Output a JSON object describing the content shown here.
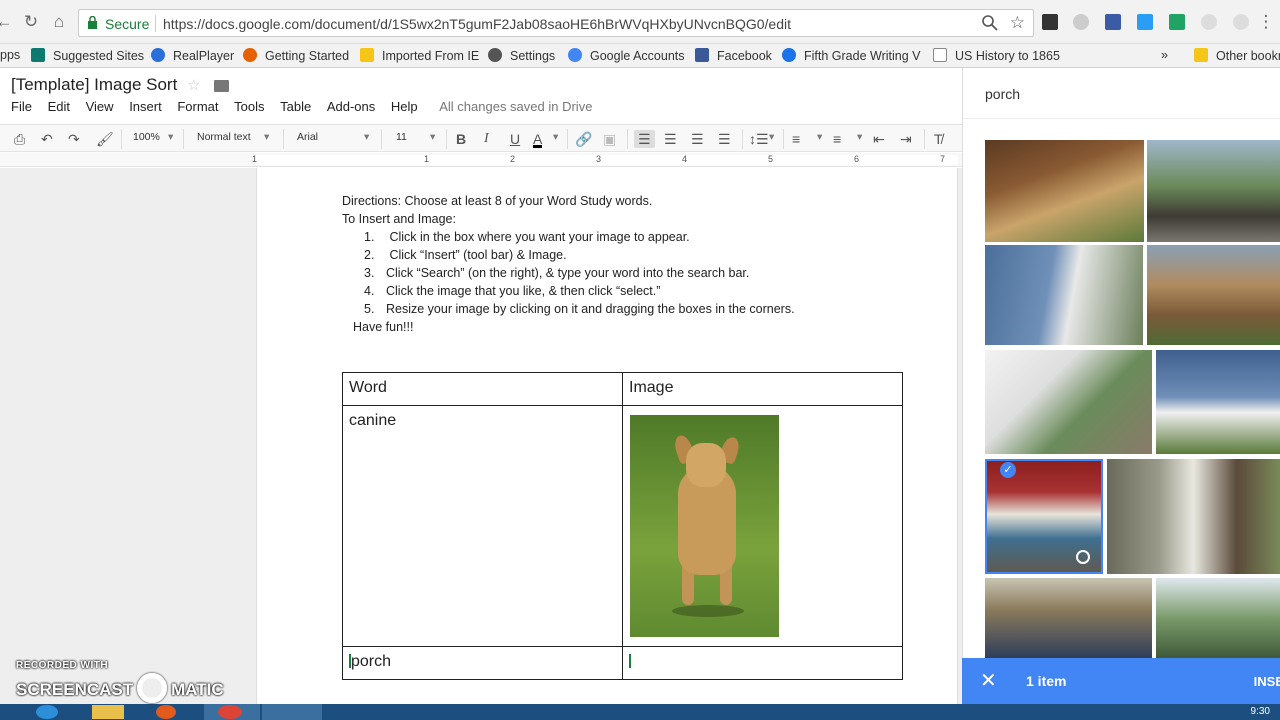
{
  "browser": {
    "secure_label": "Secure",
    "url": "https://docs.google.com/document/d/1S5wx2nT5gumF2Jab08saoHE6hBrWVqHXbyUNvcnBQG0/edit"
  },
  "bookmarks": [
    {
      "label": "pps",
      "icon": "apps-icon",
      "color": "#4285f4"
    },
    {
      "label": "Suggested Sites",
      "icon": "bing-icon",
      "color": "#0e7a6f"
    },
    {
      "label": "RealPlayer",
      "icon": "realplayer-icon",
      "color": "#2a6fdb"
    },
    {
      "label": "Getting Started",
      "icon": "firefox-icon",
      "color": "#e66000"
    },
    {
      "label": "Imported From IE",
      "icon": "folder-icon",
      "color": "#f5c518"
    },
    {
      "label": "Settings",
      "icon": "gear-icon",
      "color": "#555555"
    },
    {
      "label": "Google Accounts",
      "icon": "google-icon",
      "color": "#4285f4"
    },
    {
      "label": "Facebook",
      "icon": "facebook-icon",
      "color": "#3b5998"
    },
    {
      "label": "Fifth Grade Writing V",
      "icon": "site-icon",
      "color": "#1a73e8"
    },
    {
      "label": "US History to 1865",
      "icon": "page-icon",
      "color": "#888888"
    },
    {
      "label": "»",
      "icon": "more-icon",
      "color": "#555555"
    },
    {
      "label": "Other bookr",
      "icon": "folder-icon",
      "color": "#f5c518"
    }
  ],
  "doc": {
    "title": "[Template] Image Sort",
    "menus": [
      "File",
      "Edit",
      "View",
      "Insert",
      "Format",
      "Tools",
      "Table",
      "Add-ons",
      "Help"
    ],
    "save_status": "All changes saved in Drive"
  },
  "toolbar": {
    "zoom": "100%",
    "style": "Normal text",
    "font": "Arial",
    "size": "11"
  },
  "ruler": [
    "1",
    "1",
    "2",
    "3",
    "4",
    "5",
    "6",
    "7"
  ],
  "directions": {
    "line1": "Directions:  Choose at least 8 of your Word Study words.",
    "line2": "To Insert and Image:",
    "steps": [
      {
        "num": "1.",
        "text": " Click in the box where you want your image to appear."
      },
      {
        "num": "2.",
        "text": " Click “Insert” (tool bar) & Image."
      },
      {
        "num": "3.",
        "text": "Click “Search” (on the right), & type your word into the search bar."
      },
      {
        "num": "4.",
        "text": "Click the image that you like, & then click “select.”"
      },
      {
        "num": "5.",
        "text": "Resize your image by clicking on it and dragging the boxes in the corners."
      }
    ],
    "closing": "Have fun!!!"
  },
  "table": {
    "headers": [
      "Word",
      "Image"
    ],
    "rows": [
      "canine",
      "porch"
    ]
  },
  "panel": {
    "search_query": "porch",
    "selected_count": "1 item",
    "insert_label": "INSE"
  },
  "taskbar": {
    "clock": "9:30"
  },
  "watermark": {
    "line1": "RECORDED WITH",
    "brand_left": "SCREENCAST",
    "brand_right": "MATIC"
  },
  "colors": {
    "accent": "#4285f4",
    "secure_green": "#188038",
    "taskbar": "#1c4f80"
  }
}
